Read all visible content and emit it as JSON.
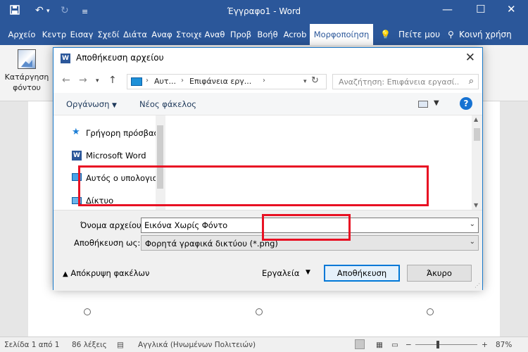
{
  "app": {
    "title": "Έγγραφο1 - Word",
    "qa_save_icon": "save-icon",
    "qa_undo_icon": "undo-icon",
    "qa_redo_icon": "redo-icon"
  },
  "tabs": [
    {
      "label": "Αρχείο"
    },
    {
      "label": "Κεντρ"
    },
    {
      "label": "Εισαγ"
    },
    {
      "label": "Σχεδί"
    },
    {
      "label": "Διάτα"
    },
    {
      "label": "Αναφ"
    },
    {
      "label": "Στοιχε"
    },
    {
      "label": "Αναθ"
    },
    {
      "label": "Προβ"
    },
    {
      "label": "Βοήθ"
    },
    {
      "label": "Acrob"
    },
    {
      "label": "Μορφοποίηση"
    }
  ],
  "tell_me": "Πείτε μου",
  "share": "Κοινή χρήση",
  "ribbon": {
    "remove_background_line1": "Κατάργηση",
    "remove_background_line2": "φόντου"
  },
  "dialog": {
    "title": "Αποθήκευση αρχείου",
    "breadcrumbs": [
      "Αυτ...",
      "Επιφάνεια εργ..."
    ],
    "search_placeholder": "Αναζήτηση: Επιφάνεια εργασί...",
    "organize": "Οργάνωση",
    "new_folder": "Νέος φάκελος",
    "nav_items": [
      {
        "label": "Γρήγορη πρόσβαση",
        "icon": "star-icon"
      },
      {
        "label": "Microsoft Word",
        "icon": "word-icon"
      },
      {
        "label": "Αυτός ο υπολογιστής",
        "icon": "computer-icon"
      },
      {
        "label": "Δίκτυο",
        "icon": "network-icon"
      }
    ],
    "filename_label": "Όνομα αρχείου:",
    "filename_value": "Εικόνα Χωρίς Φόντο",
    "savetype_label": "Αποθήκευση ως:",
    "savetype_value": "Φορητά γραφικά δικτύου (*.png)",
    "hide_folders": "Απόκρυψη φακέλων",
    "tools": "Εργαλεία",
    "save": "Αποθήκευση",
    "cancel": "Άκυρο"
  },
  "status": {
    "page": "Σελίδα 1 από 1",
    "words": "86 λέξεις",
    "language": "Αγγλικά (Ηνωμένων Πολιτειών)",
    "zoom": "87%"
  },
  "colors": {
    "word_blue": "#2b579a",
    "highlight_red": "#e81123",
    "accent_blue": "#0078d7"
  }
}
